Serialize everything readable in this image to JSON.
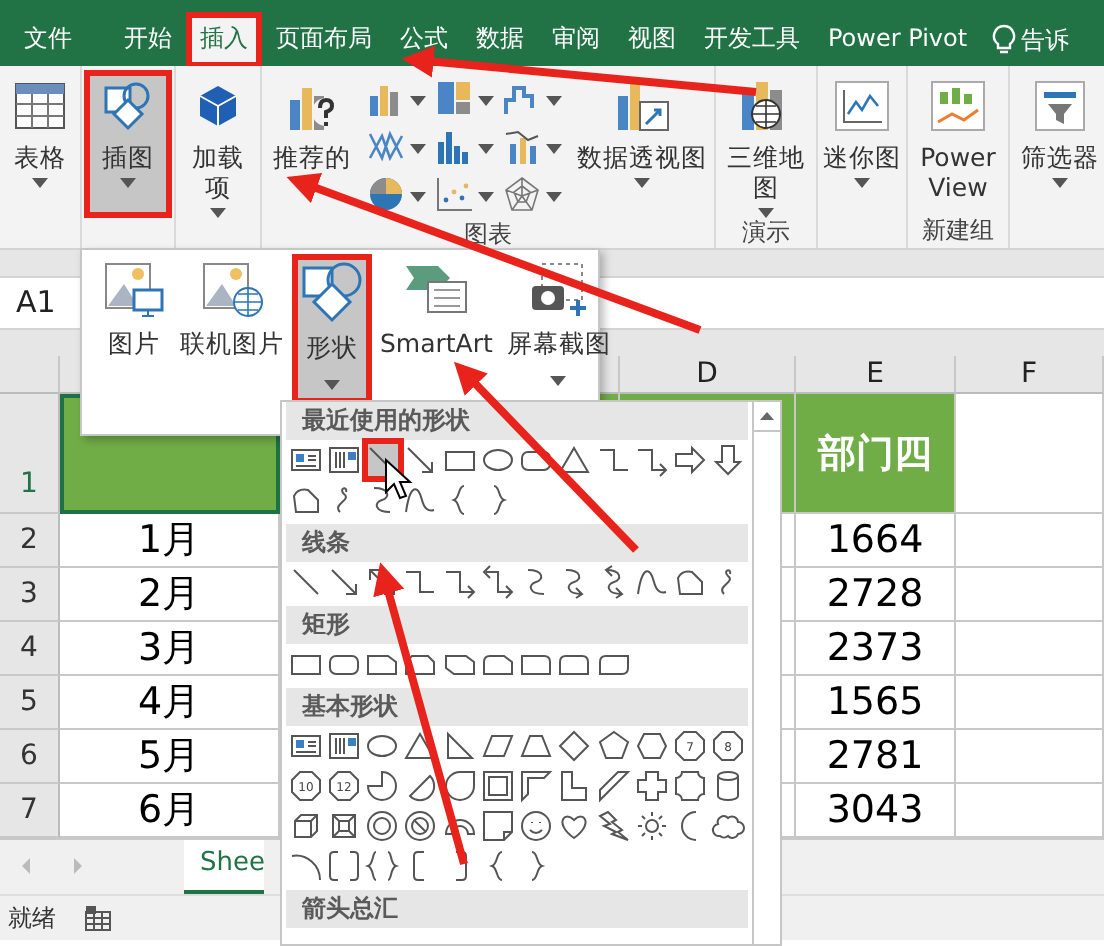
{
  "ribbon_tabs": [
    {
      "label": "文件",
      "selected": false,
      "highlighted": false
    },
    {
      "label": "开始",
      "selected": false,
      "highlighted": false
    },
    {
      "label": "插入",
      "selected": true,
      "highlighted": true
    },
    {
      "label": "页面布局",
      "selected": false,
      "highlighted": false
    },
    {
      "label": "公式",
      "selected": false,
      "highlighted": false
    },
    {
      "label": "数据",
      "selected": false,
      "highlighted": false
    },
    {
      "label": "审阅",
      "selected": false,
      "highlighted": false
    },
    {
      "label": "视图",
      "selected": false,
      "highlighted": false
    },
    {
      "label": "开发工具",
      "selected": false,
      "highlighted": false
    },
    {
      "label": "Power Pivot",
      "selected": false,
      "highlighted": false
    }
  ],
  "tell_me": "告诉",
  "ribbon_groups": [
    {
      "buttons": [
        {
          "kind": "large",
          "label": "表格",
          "dropdown": true,
          "pressed": false,
          "highlighted": false
        }
      ]
    },
    {
      "buttons": [
        {
          "kind": "large",
          "label": "插图",
          "dropdown": true,
          "pressed": true,
          "highlighted": true
        }
      ]
    },
    {
      "buttons": [
        {
          "kind": "large",
          "label": "加载项",
          "dropdown": true,
          "pressed": false,
          "highlighted": false
        }
      ]
    },
    {
      "label": "图表",
      "buttons": [
        {
          "kind": "large",
          "label": "推荐的",
          "dropdown": false,
          "pressed": false,
          "highlighted": false
        },
        {
          "kind": "chart-gallery"
        },
        {
          "kind": "large",
          "label": "数据透视图",
          "dropdown": true,
          "pressed": false,
          "highlighted": false
        }
      ]
    },
    {
      "label": "演示",
      "buttons": [
        {
          "kind": "large",
          "label": "三维地图",
          "dropdown": true,
          "pressed": false,
          "highlighted": false
        }
      ]
    },
    {
      "buttons": [
        {
          "kind": "large",
          "label": "迷你图",
          "dropdown": true,
          "pressed": false,
          "highlighted": false
        }
      ]
    },
    {
      "label": "新建组",
      "buttons": [
        {
          "kind": "large",
          "label": "Power View",
          "dropdown": false,
          "pressed": false,
          "highlighted": false
        }
      ]
    },
    {
      "buttons": [
        {
          "kind": "large",
          "label": "筛选器",
          "dropdown": true,
          "pressed": false,
          "highlighted": false
        }
      ]
    }
  ],
  "name_box": "A1",
  "column_headers": [
    "D",
    "E",
    "F"
  ],
  "header_row": {
    "number": "1",
    "selected": true,
    "column_e": "部门四"
  },
  "rows": [
    {
      "number": "2",
      "column_a": "1月",
      "column_e": "1664"
    },
    {
      "number": "3",
      "column_a": "2月",
      "column_e": "2728"
    },
    {
      "number": "4",
      "column_a": "3月",
      "column_e": "2373"
    },
    {
      "number": "5",
      "column_a": "4月",
      "column_e": "1565"
    },
    {
      "number": "6",
      "column_a": "5月",
      "column_e": "2781"
    },
    {
      "number": "7",
      "column_a": "6月",
      "column_e": "3043"
    }
  ],
  "sheet_tab": "Shee",
  "status": "就绪",
  "illustrations_menu": [
    {
      "label": "图片",
      "dropdown": false,
      "pressed": false,
      "highlighted": false
    },
    {
      "label": "联机图片",
      "dropdown": false,
      "pressed": false,
      "highlighted": false
    },
    {
      "label": "形状",
      "dropdown": true,
      "pressed": true,
      "highlighted": true
    },
    {
      "label": "SmartArt",
      "dropdown": false,
      "pressed": false,
      "highlighted": false
    },
    {
      "label": "屏幕截图",
      "dropdown": true,
      "pressed": false,
      "highlighted": false
    }
  ],
  "shape_gallery": [
    {
      "title": "最近使用的形状",
      "shapes": [
        {
          "kind": "textbox",
          "selected": false
        },
        {
          "kind": "vtextbox",
          "selected": false
        },
        {
          "kind": "line",
          "selected": true,
          "highlighted": true
        },
        {
          "kind": "arrow-line",
          "selected": false
        },
        {
          "kind": "rect",
          "selected": false
        },
        {
          "kind": "ellipse",
          "selected": false
        },
        {
          "kind": "rounded-rect",
          "selected": false
        },
        {
          "kind": "triangle",
          "selected": false
        },
        {
          "kind": "elbow",
          "selected": false
        },
        {
          "kind": "elbow-arrow",
          "selected": false
        },
        {
          "kind": "block-arrow-right",
          "selected": false
        },
        {
          "kind": "block-arrow-down",
          "selected": false
        },
        {
          "kind": "freeform",
          "selected": false
        },
        {
          "kind": "scribble",
          "selected": false
        },
        {
          "kind": "curve-connector",
          "selected": false
        },
        {
          "kind": "curve",
          "selected": false
        },
        {
          "kind": "left-brace",
          "selected": false
        },
        {
          "kind": "right-brace",
          "selected": false
        }
      ]
    },
    {
      "title": "线条",
      "shapes": [
        {
          "kind": "line",
          "selected": false
        },
        {
          "kind": "arrow-line",
          "selected": false
        },
        {
          "kind": "double-arrow-line",
          "selected": false
        },
        {
          "kind": "elbow",
          "selected": false
        },
        {
          "kind": "elbow-arrow",
          "selected": false
        },
        {
          "kind": "elbow-double",
          "selected": false
        },
        {
          "kind": "curve-connector",
          "selected": false
        },
        {
          "kind": "curve-arrow",
          "selected": false
        },
        {
          "kind": "curve-double",
          "selected": false
        },
        {
          "kind": "curve",
          "selected": false
        },
        {
          "kind": "freeform",
          "selected": false
        },
        {
          "kind": "scribble",
          "selected": false
        }
      ]
    },
    {
      "title": "矩形",
      "shapes": [
        {
          "kind": "rect",
          "selected": false
        },
        {
          "kind": "rounded-rect",
          "selected": false
        },
        {
          "kind": "snip-one",
          "selected": false
        },
        {
          "kind": "snip-same",
          "selected": false
        },
        {
          "kind": "snip-diag",
          "selected": false
        },
        {
          "kind": "snip-round",
          "selected": false
        },
        {
          "kind": "round-one",
          "selected": false
        },
        {
          "kind": "round-same",
          "selected": false
        },
        {
          "kind": "round-diag",
          "selected": false
        }
      ]
    },
    {
      "title": "基本形状",
      "shapes": [
        {
          "kind": "textbox",
          "selected": false
        },
        {
          "kind": "vtextbox",
          "selected": false
        },
        {
          "kind": "ellipse",
          "selected": false
        },
        {
          "kind": "triangle",
          "selected": false
        },
        {
          "kind": "right-triangle",
          "selected": false
        },
        {
          "kind": "parallelogram",
          "selected": false
        },
        {
          "kind": "trapezoid",
          "selected": false
        },
        {
          "kind": "diamond",
          "selected": false
        },
        {
          "kind": "pentagon",
          "selected": false
        },
        {
          "kind": "hexagon",
          "selected": false
        },
        {
          "kind": "polygon",
          "label": "7",
          "selected": false
        },
        {
          "kind": "polygon",
          "label": "8",
          "selected": false
        },
        {
          "kind": "polygon",
          "label": "10",
          "selected": false
        },
        {
          "kind": "polygon",
          "label": "12",
          "selected": false
        },
        {
          "kind": "pie",
          "selected": false
        },
        {
          "kind": "chord",
          "selected": false
        },
        {
          "kind": "teardrop",
          "selected": false
        },
        {
          "kind": "frame",
          "selected": false
        },
        {
          "kind": "half-frame",
          "selected": false
        },
        {
          "kind": "l-shape",
          "selected": false
        },
        {
          "kind": "diagonal-stripe",
          "selected": false
        },
        {
          "kind": "cross",
          "selected": false
        },
        {
          "kind": "plaque",
          "selected": false
        },
        {
          "kind": "can",
          "selected": false
        },
        {
          "kind": "cube",
          "selected": false
        },
        {
          "kind": "bevel",
          "selected": false
        },
        {
          "kind": "donut",
          "selected": false
        },
        {
          "kind": "no-symbol",
          "selected": false
        },
        {
          "kind": "block-arc",
          "selected": false
        },
        {
          "kind": "folded-corner",
          "selected": false
        },
        {
          "kind": "smiley",
          "selected": false
        },
        {
          "kind": "heart",
          "selected": false
        },
        {
          "kind": "lightning",
          "selected": false
        },
        {
          "kind": "sun",
          "selected": false
        },
        {
          "kind": "moon",
          "selected": false
        },
        {
          "kind": "cloud",
          "selected": false
        },
        {
          "kind": "arc",
          "selected": false
        },
        {
          "kind": "bracket-pair",
          "selected": false
        },
        {
          "kind": "brace-pair",
          "selected": false
        },
        {
          "kind": "left-bracket",
          "selected": false
        },
        {
          "kind": "right-bracket",
          "selected": false
        },
        {
          "kind": "left-brace",
          "selected": false
        },
        {
          "kind": "right-brace",
          "selected": false
        }
      ]
    },
    {
      "title": "箭头总汇"
    }
  ]
}
